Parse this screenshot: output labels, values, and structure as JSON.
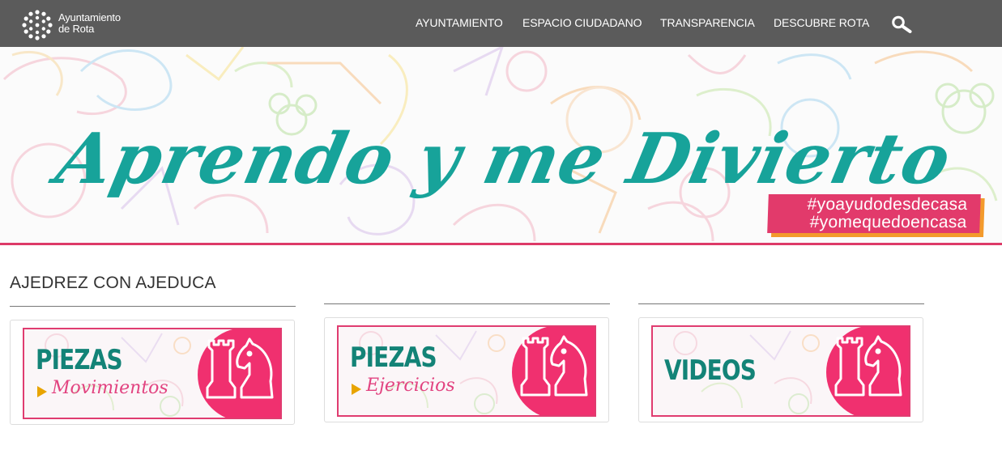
{
  "header": {
    "logo_line1": "Ayuntamiento",
    "logo_line2": "de Rota",
    "nav": [
      "AYUNTAMIENTO",
      "ESPACIO CIUDADANO",
      "TRANSPARENCIA",
      "DESCUBRE ROTA"
    ],
    "search_icon": "search-icon"
  },
  "hero": {
    "title": "Aprendo y me Divierto",
    "hashtag1": "#yoayudodesdecasa",
    "hashtag2": "#yomequedoencasa"
  },
  "section": {
    "title": "AJEDREZ CON AJEDUCA"
  },
  "cards": [
    {
      "main": "PIEZAS",
      "sub": "Movimientos"
    },
    {
      "main": "PIEZAS",
      "sub": "Ejercicios"
    },
    {
      "main": "VIDEOS",
      "sub": ""
    }
  ],
  "colors": {
    "nav_bg": "#5b5b5b",
    "teal": "#17a39a",
    "pink": "#e23a6b",
    "orange": "#f39a2c"
  }
}
